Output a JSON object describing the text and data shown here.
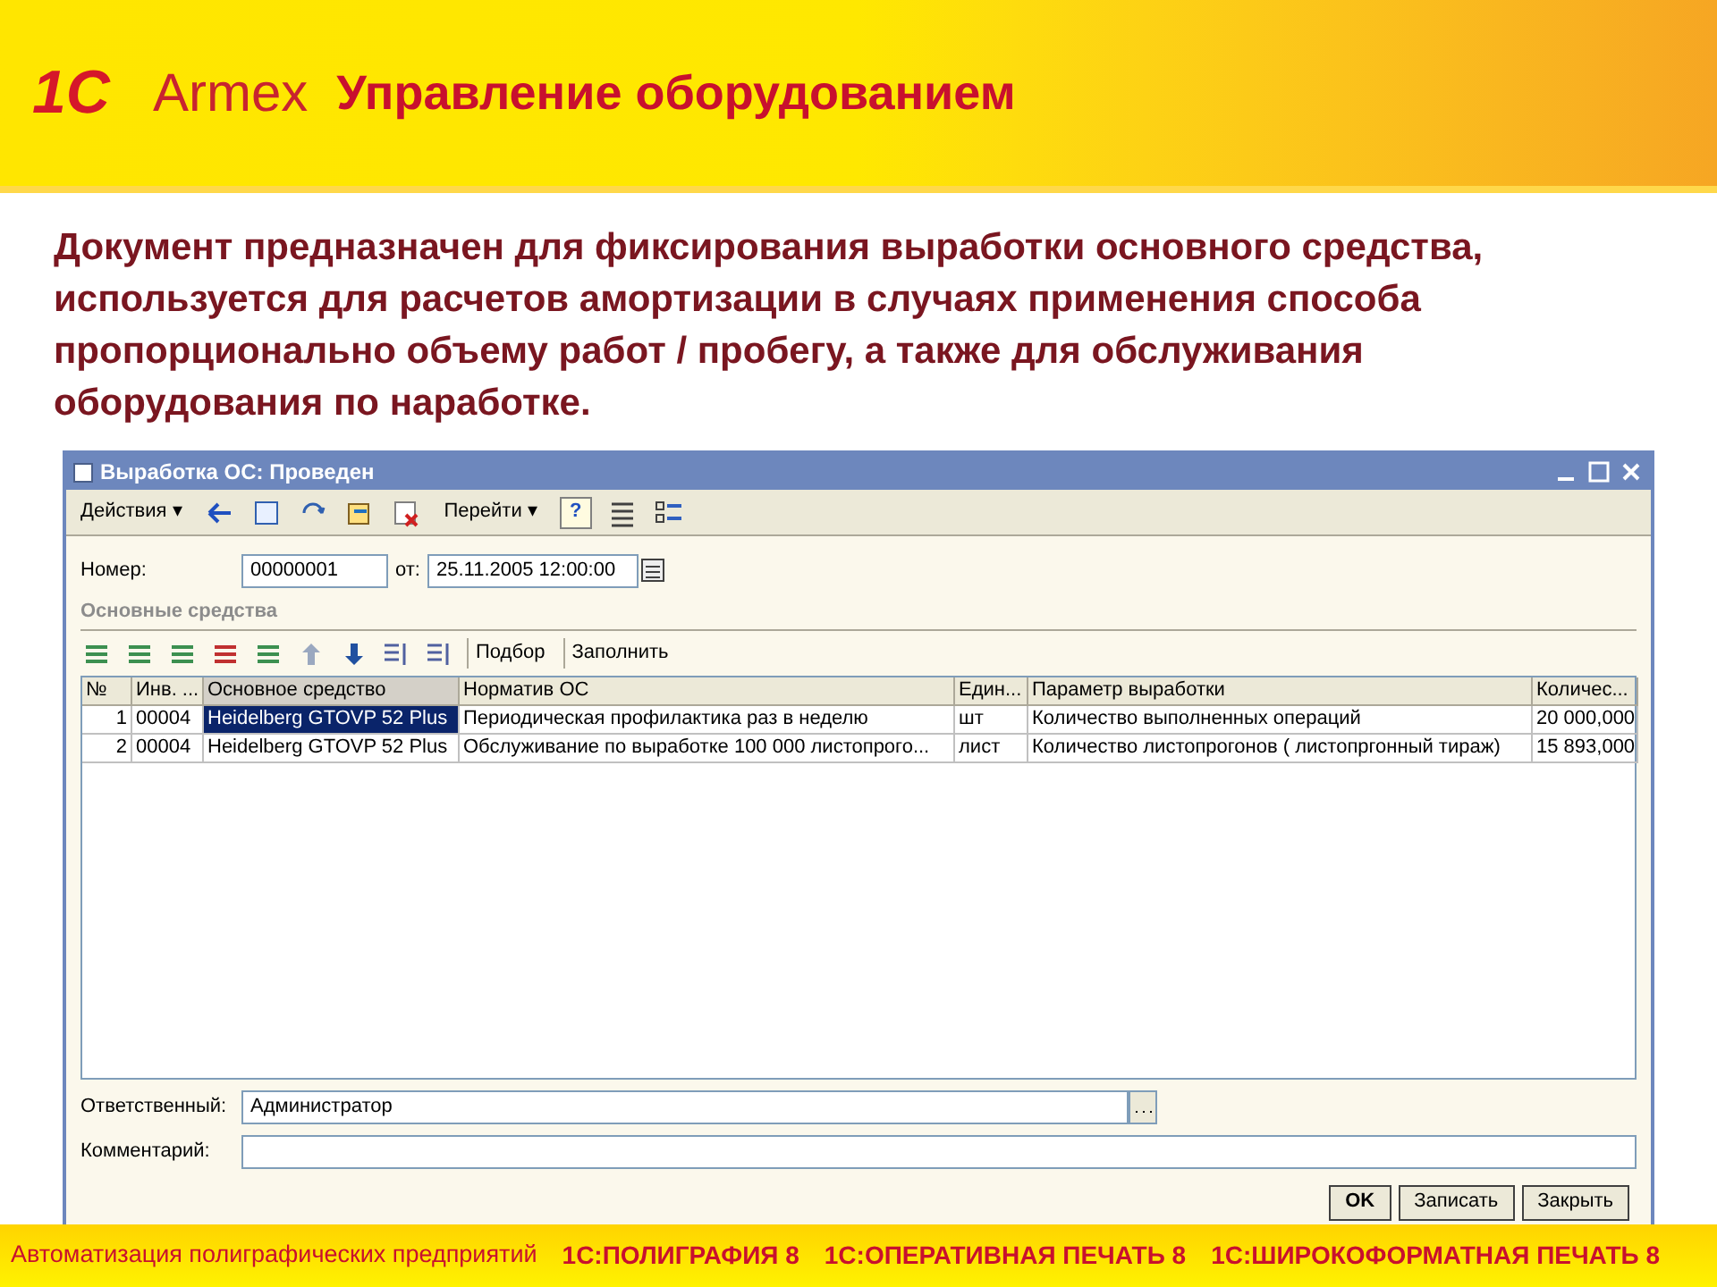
{
  "header": {
    "logo_1c": "1С",
    "logo_armex": "Armex",
    "title": "Управление оборудованием"
  },
  "description": "Документ предназначен для фиксирования выработки основного средства, используется для расчетов амортизации в случаях применения способа пропорционально объему работ / пробегу, а также для обслуживания оборудования по наработке.",
  "window": {
    "title": "Выработка ОС: Проведен",
    "toolbar": {
      "actions": "Действия ▾",
      "goto": "Перейти ▾",
      "help": "?"
    },
    "number_label": "Номер:",
    "number": "00000001",
    "date_label": "от:",
    "date": "25.11.2005 12:00:00",
    "section": "Основные средства",
    "table_toolbar": {
      "pick": "Подбор",
      "fill": "Заполнить"
    },
    "table": {
      "columns": [
        "№",
        "Инв. ...",
        "Основное средство",
        "Норматив ОС",
        "Един...",
        "Параметр выработки",
        "Количес..."
      ],
      "rows": [
        {
          "cells": [
            "1",
            "00004",
            "Heidelberg GTOVP 52 Plus",
            "Периодическая профилактика раз в неделю",
            "шт",
            "Количество выполненных операций",
            "20 000,000"
          ],
          "selected": true
        },
        {
          "cells": [
            "2",
            "00004",
            "Heidelberg GTOVP 52 Plus",
            "Обслуживание по  выработке 100 000 листопрого...",
            "лист",
            "Количество листопрогонов  ( листопргонный тираж)",
            "15 893,000"
          ],
          "selected": false
        }
      ]
    },
    "responsible_label": "Ответственный:",
    "responsible": "Администратор",
    "comment_label": "Комментарий:",
    "buttons": [
      "OK",
      "Записать",
      "Закрыть"
    ]
  },
  "footer": [
    "Автоматизация полиграфических предприятий",
    "1С:ПОЛИГРАФИЯ 8",
    "1С:ОПЕРАТИВНАЯ ПЕЧАТЬ 8",
    "1С:ШИРОКОФОРМАТНАЯ ПЕЧАТЬ 8"
  ]
}
